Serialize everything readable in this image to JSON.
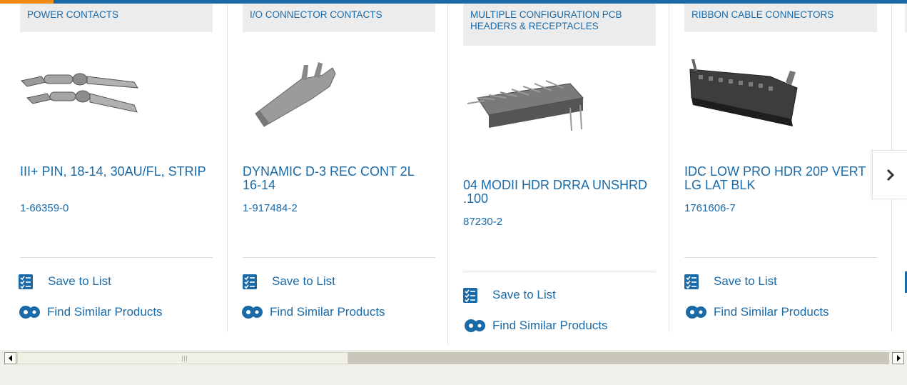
{
  "products": [
    {
      "category": "POWER CONTACTS",
      "title": "III+ PIN, 18-14, 30AU/FL, STRIP",
      "part_number": "1-66359-0",
      "save_label": "Save to List",
      "find_label": "Find Similar Products"
    },
    {
      "category": "I/O CONNECTOR CONTACTS",
      "title": "DYNAMIC D-3 REC CONT 2L 16-14",
      "part_number": "1-917484-2",
      "save_label": "Save to List",
      "find_label": "Find Similar Products"
    },
    {
      "category": "MULTIPLE CONFIGURATION PCB HEADERS & RECEPTACLES",
      "title": "04 MODII HDR DRRA UNSHRD .100",
      "part_number": "87230-2",
      "save_label": "Save to List",
      "find_label": "Find Similar Products"
    },
    {
      "category": "RIBBON CABLE CONNECTORS",
      "title": "IDC LOW PRO HDR 20P VERT LG LAT BLK",
      "part_number": "1761606-7",
      "save_label": "Save to List",
      "find_label": "Find Similar Products"
    }
  ],
  "icons": {
    "next": "chevron-right-icon",
    "save": "checklist-icon",
    "find": "gears-icon",
    "scroll_left": "scroll-left-arrow-icon",
    "scroll_right": "scroll-right-arrow-icon"
  },
  "colors": {
    "link": "#1a6aa8",
    "accent": "#ef8a17",
    "category_bg": "#ececec"
  },
  "scroll": {
    "thumb_fraction": 0.38
  }
}
